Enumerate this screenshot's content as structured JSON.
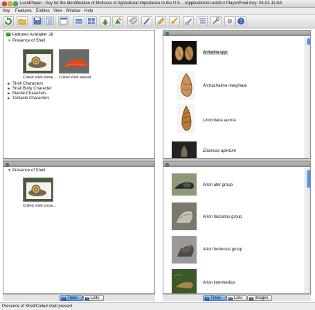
{
  "window": {
    "title": "LucidPlayer - Key for the Identification of Molluscs of Agricultural Importance to the U.S. - /Applications/Lucid3.4 Player/Final Key- 04-01-11.lk4"
  },
  "menu": [
    "Key",
    "Features",
    "Entities",
    "View",
    "Window",
    "Help"
  ],
  "features_available": {
    "header": "Features Available: 26",
    "expanded_item": "Presence of Shell",
    "states": [
      "Coiled shell prese...",
      "Coiled shell absent"
    ],
    "collapsed_items": [
      "Shell Characters",
      "Snail Body Character",
      "Mantle Characters",
      "Tentacle Characters"
    ]
  },
  "features_chosen": {
    "expanded_item": "Presence of Shell",
    "states": [
      "Coiled shell prese..."
    ]
  },
  "entities_remaining": {
    "items": [
      {
        "label": "Achatina spp.",
        "italic": true,
        "selected": true
      },
      {
        "label": "Archachatina marginata",
        "italic": true,
        "selected": false
      },
      {
        "label": "Limicolaria aurora",
        "italic": true,
        "selected": false
      },
      {
        "label": "Elasmias apertum",
        "italic": true,
        "selected": false
      }
    ]
  },
  "entities_discarded": {
    "items": [
      {
        "label": "Arion ater group"
      },
      {
        "label": "Arion fasciatus group"
      },
      {
        "label": "Arion hortensis group"
      },
      {
        "label": "Arion intermedius"
      }
    ]
  },
  "tabs_left": {
    "trees": "Trees",
    "lists": "Lists"
  },
  "tabs_right": {
    "trees": "Trees",
    "lists": "Lists",
    "images": "Images"
  },
  "status": "Presence of Shell/Coiled shell present",
  "colors": {
    "accent": "#5d9ae8",
    "panel_header": "#a9a9a9",
    "selected_row": "#cfcfcf"
  }
}
